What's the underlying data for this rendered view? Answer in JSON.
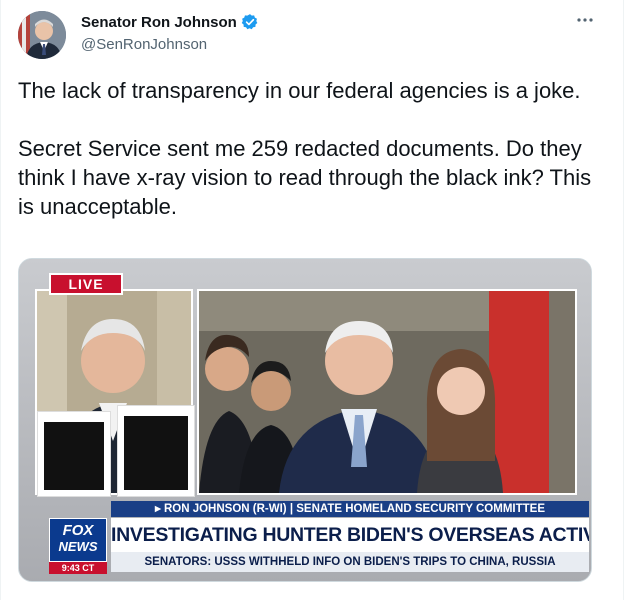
{
  "author": {
    "name": "Senator Ron Johnson",
    "handle": "@SenRonJohnson",
    "verified_color": "#1d9bf0"
  },
  "more_label": "···",
  "tweet": {
    "paragraph1": "The lack of transparency in our federal agencies is a joke.",
    "paragraph2": "Secret Service sent me 259 redacted documents. Do they think I have x-ray vision to read through the black ink? This is unacceptable."
  },
  "media": {
    "live_badge": "LIVE",
    "chyron_top": "▸ RON JOHNSON (R-WI) | SENATE HOMELAND SECURITY COMMITTEE",
    "chyron_main": "INVESTIGATING HUNTER BIDEN'S OVERSEAS ACTIVITIES",
    "chyron_bottom": "SENATORS: USSS WITHHELD INFO ON BIDEN'S TRIPS TO CHINA, RUSSIA",
    "network_logo_line1": "FOX",
    "network_logo_line2": "NEWS",
    "clock": "9:43 CT",
    "colors": {
      "live_red": "#c8102e",
      "fox_blue": "#0b3a8e",
      "chyron_navy": "#1a3f86"
    }
  }
}
